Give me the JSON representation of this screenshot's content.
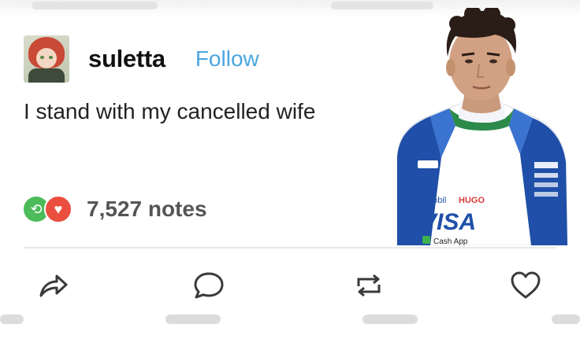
{
  "post": {
    "username": "suletta",
    "follow_label": "Follow",
    "text": "I stand with my cancelled wife",
    "notes_count": "7,527 notes"
  },
  "photo": {
    "sponsor_visa": "VISA",
    "sponsor_hugo": "HUGO",
    "sponsor_cashapp": "Cash App",
    "sponsor_mobil": "Mobil"
  },
  "icons": {
    "share": "share-icon",
    "reply": "reply-icon",
    "reblog": "reblog-icon",
    "like": "heart-icon"
  },
  "colors": {
    "follow": "#4aa6e0",
    "reblog_badge": "#4cbb5a",
    "like_badge": "#ea4e3f"
  }
}
